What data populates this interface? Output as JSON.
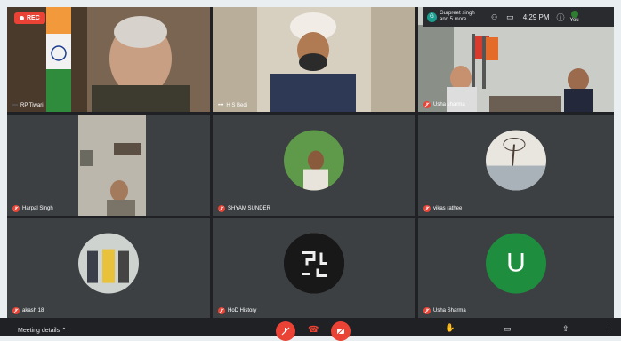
{
  "rec_label": "REC",
  "topbar": {
    "participants": "Gurpreet singh and 5 more",
    "time": "4:29 PM",
    "you_label": "You"
  },
  "tiles": [
    {
      "name": "RP Tiwari"
    },
    {
      "name": "H S Bedi"
    },
    {
      "name": "Usha sharma"
    },
    {
      "name": "Harpal Singh"
    },
    {
      "name": "SHYAM SUNDER"
    },
    {
      "name": "vikas rathee"
    },
    {
      "name": "akash 18"
    },
    {
      "name": "HoD History"
    },
    {
      "name": "Usha Sharma"
    }
  ],
  "avatar_letter": "U",
  "bottom": {
    "meeting_details": "Meeting details"
  },
  "colors": {
    "accent_red": "#ea4335",
    "bg": "#202124",
    "tile": "#3c4043",
    "avatar_green": "#1e8e3e"
  }
}
